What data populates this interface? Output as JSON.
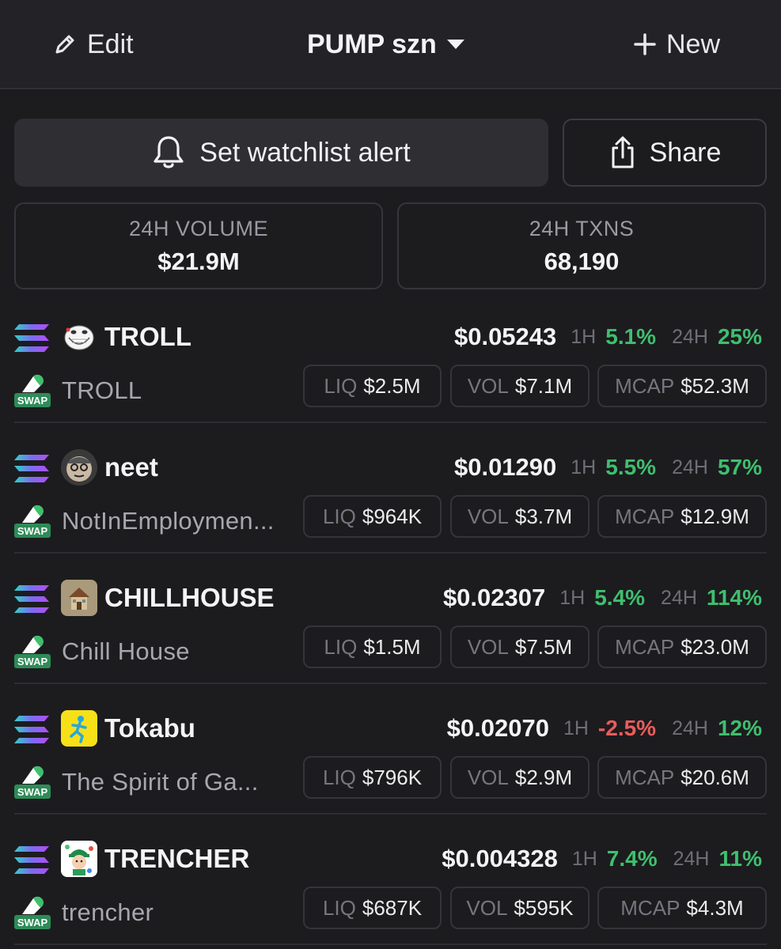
{
  "header": {
    "edit_label": "Edit",
    "title": "PUMP szn",
    "new_label": "New"
  },
  "actions": {
    "alert_label": "Set watchlist alert",
    "share_label": "Share"
  },
  "stats": {
    "volume_label": "24H VOLUME",
    "volume_value": "$21.9M",
    "txns_label": "24H TXNS",
    "txns_value": "68,190"
  },
  "colors": {
    "positive": "#3fbf6e",
    "negative": "#ec5b5b",
    "background": "#1c1c1f"
  },
  "tokens": [
    {
      "symbol": "TROLL",
      "name": "TROLL",
      "price": "$0.05243",
      "h1_label": "1H",
      "h1": "5.1%",
      "h1_dir": "up",
      "h24_label": "24H",
      "h24": "25%",
      "h24_dir": "up",
      "liq_label": "LIQ",
      "liq": "$2.5M",
      "vol_label": "VOL",
      "vol": "$7.1M",
      "mcap_label": "MCAP",
      "mcap": "$52.3M",
      "avatar_icon": "troll-face-icon"
    },
    {
      "symbol": "neet",
      "name": "NotInEmploymen...",
      "price": "$0.01290",
      "h1_label": "1H",
      "h1": "5.5%",
      "h1_dir": "up",
      "h24_label": "24H",
      "h24": "57%",
      "h24_dir": "up",
      "liq_label": "LIQ",
      "liq": "$964K",
      "vol_label": "VOL",
      "vol": "$3.7M",
      "mcap_label": "MCAP",
      "mcap": "$12.9M",
      "avatar_icon": "neet-face-icon"
    },
    {
      "symbol": "CHILLHOUSE",
      "name": "Chill House",
      "price": "$0.02307",
      "h1_label": "1H",
      "h1": "5.4%",
      "h1_dir": "up",
      "h24_label": "24H",
      "h24": "114%",
      "h24_dir": "up",
      "liq_label": "LIQ",
      "liq": "$1.5M",
      "vol_label": "VOL",
      "vol": "$7.5M",
      "mcap_label": "MCAP",
      "mcap": "$23.0M",
      "avatar_icon": "house-icon"
    },
    {
      "symbol": "Tokabu",
      "name": "The Spirit of Ga...",
      "price": "$0.02070",
      "h1_label": "1H",
      "h1": "-2.5%",
      "h1_dir": "down",
      "h24_label": "24H",
      "h24": "12%",
      "h24_dir": "up",
      "liq_label": "LIQ",
      "liq": "$796K",
      "vol_label": "VOL",
      "vol": "$2.9M",
      "mcap_label": "MCAP",
      "mcap": "$20.6M",
      "avatar_icon": "running-figure-icon"
    },
    {
      "symbol": "TRENCHER",
      "name": "trencher",
      "price": "$0.004328",
      "h1_label": "1H",
      "h1": "7.4%",
      "h1_dir": "up",
      "h24_label": "24H",
      "h24": "11%",
      "h24_dir": "up",
      "liq_label": "LIQ",
      "liq": "$687K",
      "vol_label": "VOL",
      "vol": "$595K",
      "mcap_label": "MCAP",
      "mcap": "$4.3M",
      "avatar_icon": "trencher-character-icon"
    }
  ]
}
